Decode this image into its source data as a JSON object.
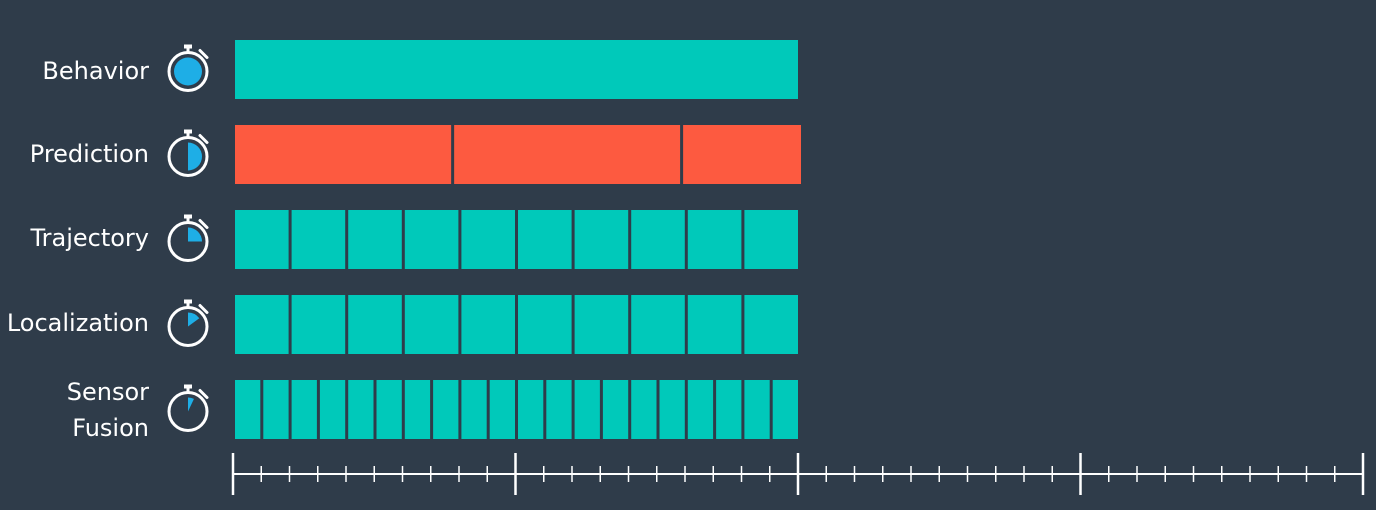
{
  "colors": {
    "background": "#2f3c4a",
    "teal": "#00c9ba",
    "coral": "#fd5a40",
    "icon_fill": "#1eaee6",
    "icon_stroke": "#ffffff",
    "axis": "#ffffff"
  },
  "rows": [
    {
      "label": "Behavior",
      "icon": "stopwatch-icon",
      "icon_fill_fraction": 1.0,
      "segments": 1,
      "color": "teal"
    },
    {
      "label": "Prediction",
      "icon": "stopwatch-icon",
      "icon_fill_fraction": 0.5,
      "segments": 3,
      "color": "coral",
      "segment_weights": [
        22,
        23,
        12
      ]
    },
    {
      "label": "Trajectory",
      "icon": "stopwatch-icon",
      "icon_fill_fraction": 0.25,
      "segments": 10,
      "color": "teal"
    },
    {
      "label": "Localization",
      "icon": "stopwatch-icon",
      "icon_fill_fraction": 0.15,
      "segments": 10,
      "color": "teal"
    },
    {
      "label": "Sensor\nFusion",
      "icon": "stopwatch-icon",
      "icon_fill_fraction": 0.07,
      "segments": 20,
      "color": "teal"
    }
  ],
  "timeline": {
    "major_divisions": 4,
    "minor_per_major": 10
  }
}
